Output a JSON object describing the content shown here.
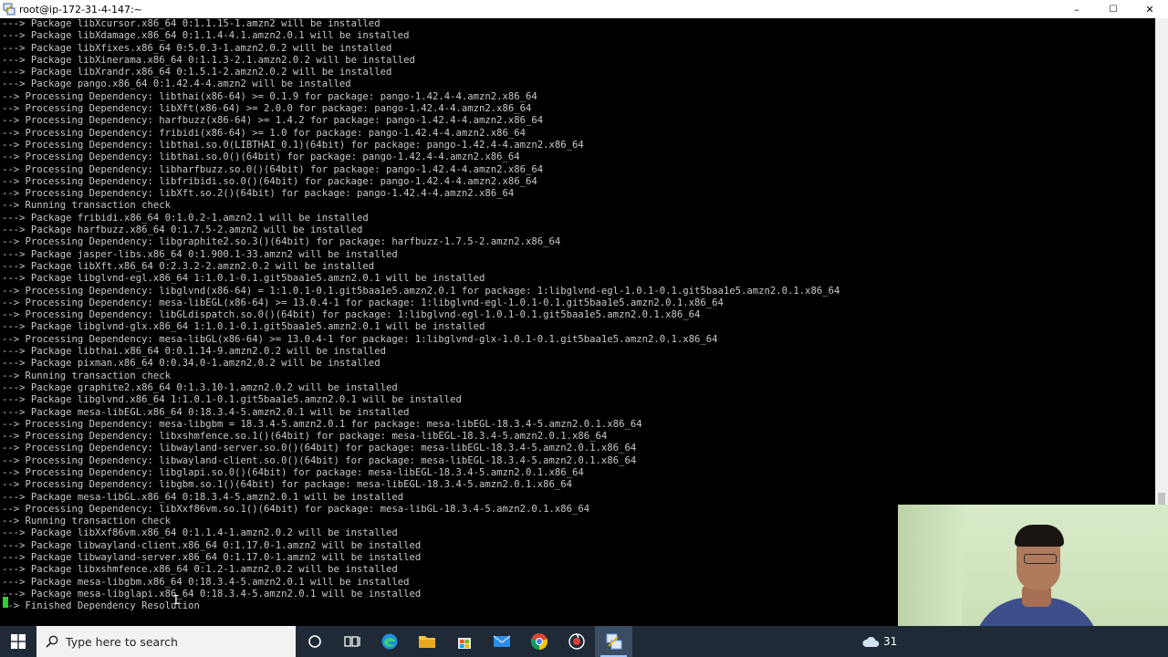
{
  "window": {
    "title": "root@ip-172-31-4-147:~",
    "controls": {
      "minimize": "–",
      "maximize": "☐",
      "close": "✕"
    }
  },
  "terminal": {
    "lines": [
      "---> Package libXcursor.x86_64 0:1.1.15-1.amzn2 will be installed",
      "---> Package libXdamage.x86_64 0:1.1.4-4.1.amzn2.0.1 will be installed",
      "---> Package libXfixes.x86_64 0:5.0.3-1.amzn2.0.2 will be installed",
      "---> Package libXinerama.x86_64 0:1.1.3-2.1.amzn2.0.2 will be installed",
      "---> Package libXrandr.x86_64 0:1.5.1-2.amzn2.0.2 will be installed",
      "---> Package pango.x86_64 0:1.42.4-4.amzn2 will be installed",
      "--> Processing Dependency: libthai(x86-64) >= 0.1.9 for package: pango-1.42.4-4.amzn2.x86_64",
      "--> Processing Dependency: libXft(x86-64) >= 2.0.0 for package: pango-1.42.4-4.amzn2.x86_64",
      "--> Processing Dependency: harfbuzz(x86-64) >= 1.4.2 for package: pango-1.42.4-4.amzn2.x86_64",
      "--> Processing Dependency: fribidi(x86-64) >= 1.0 for package: pango-1.42.4-4.amzn2.x86_64",
      "--> Processing Dependency: libthai.so.0(LIBTHAI_0.1)(64bit) for package: pango-1.42.4-4.amzn2.x86_64",
      "--> Processing Dependency: libthai.so.0()(64bit) for package: pango-1.42.4-4.amzn2.x86_64",
      "--> Processing Dependency: libharfbuzz.so.0()(64bit) for package: pango-1.42.4-4.amzn2.x86_64",
      "--> Processing Dependency: libfribidi.so.0()(64bit) for package: pango-1.42.4-4.amzn2.x86_64",
      "--> Processing Dependency: libXft.so.2()(64bit) for package: pango-1.42.4-4.amzn2.x86_64",
      "--> Running transaction check",
      "---> Package fribidi.x86_64 0:1.0.2-1.amzn2.1 will be installed",
      "---> Package harfbuzz.x86_64 0:1.7.5-2.amzn2 will be installed",
      "--> Processing Dependency: libgraphite2.so.3()(64bit) for package: harfbuzz-1.7.5-2.amzn2.x86_64",
      "---> Package jasper-libs.x86_64 0:1.900.1-33.amzn2 will be installed",
      "---> Package libXft.x86_64 0:2.3.2-2.amzn2.0.2 will be installed",
      "---> Package libglvnd-egl.x86_64 1:1.0.1-0.1.git5baa1e5.amzn2.0.1 will be installed",
      "--> Processing Dependency: libglvnd(x86-64) = 1:1.0.1-0.1.git5baa1e5.amzn2.0.1 for package: 1:libglvnd-egl-1.0.1-0.1.git5baa1e5.amzn2.0.1.x86_64",
      "--> Processing Dependency: mesa-libEGL(x86-64) >= 13.0.4-1 for package: 1:libglvnd-egl-1.0.1-0.1.git5baa1e5.amzn2.0.1.x86_64",
      "--> Processing Dependency: libGLdispatch.so.0()(64bit) for package: 1:libglvnd-egl-1.0.1-0.1.git5baa1e5.amzn2.0.1.x86_64",
      "---> Package libglvnd-glx.x86_64 1:1.0.1-0.1.git5baa1e5.amzn2.0.1 will be installed",
      "--> Processing Dependency: mesa-libGL(x86-64) >= 13.0.4-1 for package: 1:libglvnd-glx-1.0.1-0.1.git5baa1e5.amzn2.0.1.x86_64",
      "---> Package libthai.x86_64 0:0.1.14-9.amzn2.0.2 will be installed",
      "---> Package pixman.x86_64 0:0.34.0-1.amzn2.0.2 will be installed",
      "--> Running transaction check",
      "---> Package graphite2.x86_64 0:1.3.10-1.amzn2.0.2 will be installed",
      "---> Package libglvnd.x86_64 1:1.0.1-0.1.git5baa1e5.amzn2.0.1 will be installed",
      "---> Package mesa-libEGL.x86_64 0:18.3.4-5.amzn2.0.1 will be installed",
      "--> Processing Dependency: mesa-libgbm = 18.3.4-5.amzn2.0.1 for package: mesa-libEGL-18.3.4-5.amzn2.0.1.x86_64",
      "--> Processing Dependency: libxshmfence.so.1()(64bit) for package: mesa-libEGL-18.3.4-5.amzn2.0.1.x86_64",
      "--> Processing Dependency: libwayland-server.so.0()(64bit) for package: mesa-libEGL-18.3.4-5.amzn2.0.1.x86_64",
      "--> Processing Dependency: libwayland-client.so.0()(64bit) for package: mesa-libEGL-18.3.4-5.amzn2.0.1.x86_64",
      "--> Processing Dependency: libglapi.so.0()(64bit) for package: mesa-libEGL-18.3.4-5.amzn2.0.1.x86_64",
      "--> Processing Dependency: libgbm.so.1()(64bit) for package: mesa-libEGL-18.3.4-5.amzn2.0.1.x86_64",
      "---> Package mesa-libGL.x86_64 0:18.3.4-5.amzn2.0.1 will be installed",
      "--> Processing Dependency: libXxf86vm.so.1()(64bit) for package: mesa-libGL-18.3.4-5.amzn2.0.1.x86_64",
      "--> Running transaction check",
      "---> Package libXxf86vm.x86_64 0:1.1.4-1.amzn2.0.2 will be installed",
      "---> Package libwayland-client.x86_64 0:1.17.0-1.amzn2 will be installed",
      "---> Package libwayland-server.x86_64 0:1.17.0-1.amzn2 will be installed",
      "---> Package libxshmfence.x86_64 0:1.2-1.amzn2.0.2 will be installed",
      "---> Package mesa-libgbm.x86_64 0:18.3.4-5.amzn2.0.1 will be installed",
      "---> Package mesa-libglapi.x86_64 0:18.3.4-5.amzn2.0.1 will be installed",
      "--> Finished Dependency Resolution"
    ]
  },
  "taskbar": {
    "search_placeholder": "Type here to search",
    "weather_temp": "31"
  },
  "colors": {
    "terminal_bg": "#000000",
    "terminal_fg": "#c8c8c8",
    "cursor": "#2fd12f",
    "taskbar_bg": "#1f2a36"
  }
}
